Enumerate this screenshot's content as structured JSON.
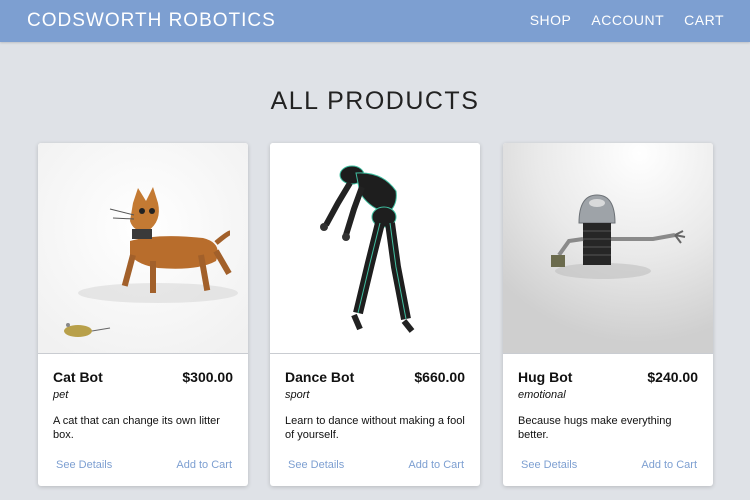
{
  "header": {
    "brand": "CODSWORTH ROBOTICS",
    "nav": [
      "SHOP",
      "ACCOUNT",
      "CART"
    ],
    "bar_color": "#7d9fd1"
  },
  "main": {
    "title": "ALL PRODUCTS",
    "products": [
      {
        "name": "Cat Bot",
        "price": "$300.00",
        "category": "pet",
        "description": "A cat that can change its own litter box.",
        "details_label": "See Details",
        "cart_label": "Add to Cart",
        "image_icon": "cat-robot-image"
      },
      {
        "name": "Dance Bot",
        "price": "$660.00",
        "category": "sport",
        "description": "Learn to dance without making a fool of yourself.",
        "details_label": "See Details",
        "cart_label": "Add to Cart",
        "image_icon": "dancing-robot-image"
      },
      {
        "name": "Hug Bot",
        "price": "$240.00",
        "category": "emotional",
        "description": "Because hugs make everything better.",
        "details_label": "See Details",
        "cart_label": "Add to Cart",
        "image_icon": "hugging-robot-image"
      }
    ]
  },
  "colors": {
    "background": "#dfe2e7",
    "link": "#7d9fd1"
  }
}
